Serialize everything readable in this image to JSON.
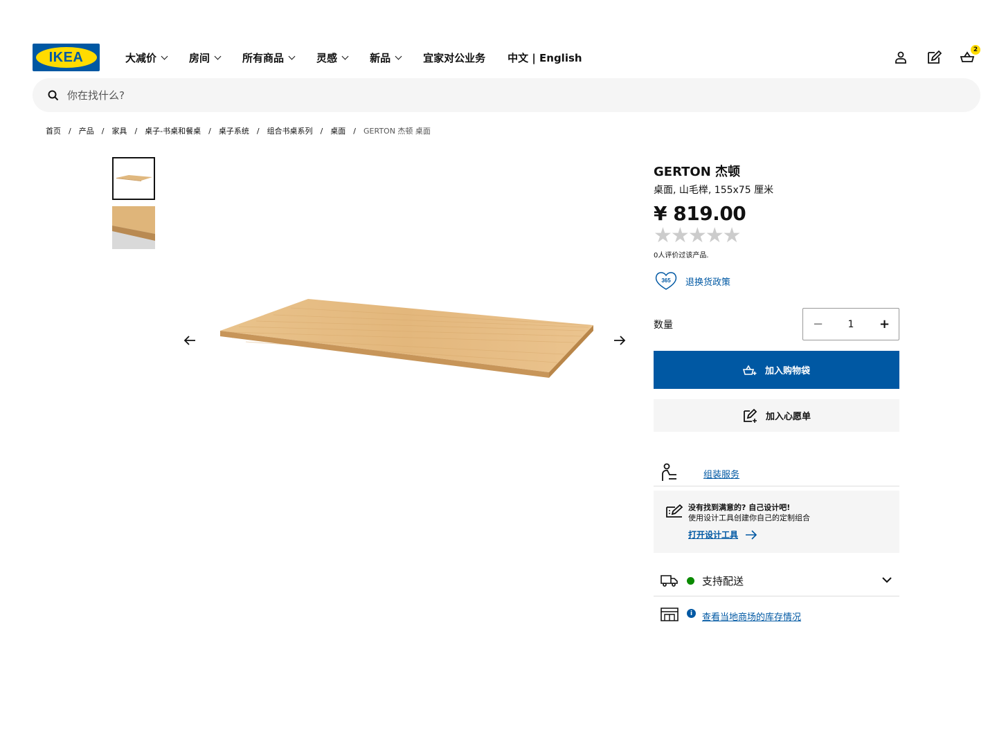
{
  "header": {
    "logo_text": "IKEA",
    "nav": [
      {
        "label": "大减价",
        "dropdown": true
      },
      {
        "label": "房间",
        "dropdown": true
      },
      {
        "label": "所有商品",
        "dropdown": true
      },
      {
        "label": "灵感",
        "dropdown": true
      },
      {
        "label": "新品",
        "dropdown": true
      },
      {
        "label": "宜家对公业务",
        "dropdown": false
      },
      {
        "label": "中文 | English",
        "dropdown": false
      }
    ],
    "cart_count": "2",
    "icons": [
      "user-icon",
      "wishlist-icon",
      "cart-icon"
    ]
  },
  "search": {
    "placeholder": "你在找什么?"
  },
  "breadcrumb": [
    "首页",
    "产品",
    "家具",
    "桌子-书桌和餐桌",
    "桌子系统",
    "组合书桌系列",
    "桌面",
    "GERTON 杰顿 桌面"
  ],
  "product": {
    "name": "GERTON 杰顿",
    "description": "桌面, 山毛榉, 155x75 厘米",
    "price": "¥ 819.00",
    "rating": 0,
    "review_text": "0人评价过该产品.",
    "policy_badge": "365",
    "policy_link": "退换货政策",
    "quantity_label": "数量",
    "quantity": "1",
    "minus": "−",
    "plus": "+",
    "add_to_cart": "加入购物袋",
    "add_to_wishlist": "加入心愿单",
    "assembly_link": "组装服务",
    "design_title": "没有找到满意的? 自己设计吧!",
    "design_sub": "使用设计工具创建你自己的定制组合",
    "design_link": "打开设计工具",
    "delivery": "支持配送",
    "stock_link": "查看当地商场的库存情况"
  },
  "colors": {
    "brand_blue": "#0058a3",
    "brand_yellow": "#ffdb00",
    "in_stock_green": "#0a8a00"
  }
}
